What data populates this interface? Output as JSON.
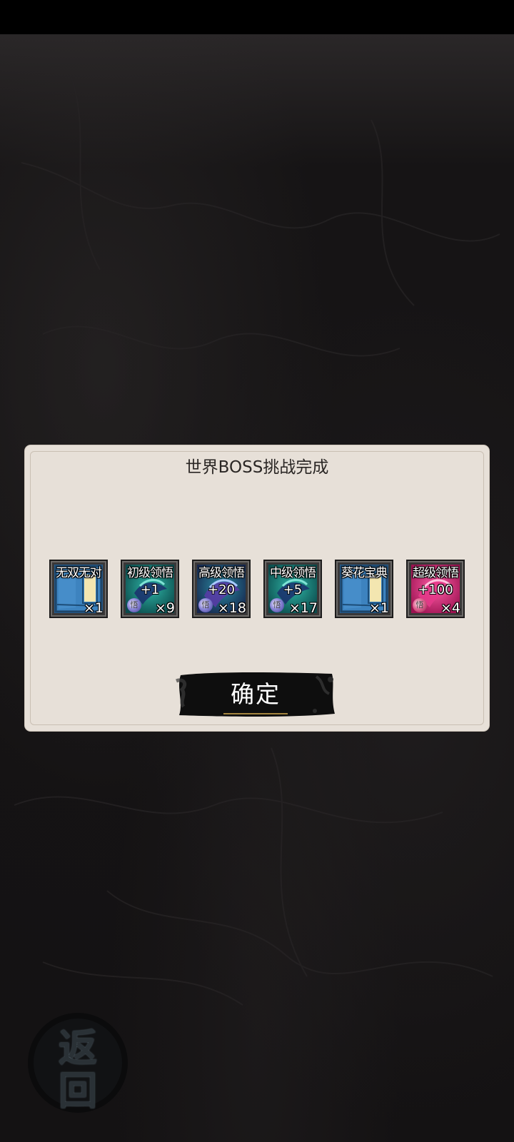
{
  "dialog": {
    "title": "世界BOSS挑战完成",
    "confirm_label": "确定"
  },
  "rewards": [
    {
      "name": "无双无对",
      "bonus": "",
      "count": "×1",
      "icon": "blue-manual-icon"
    },
    {
      "name": "初级领悟",
      "bonus": "+1",
      "count": "×9",
      "icon": "teal-insight-pill-icon"
    },
    {
      "name": "高级领悟",
      "bonus": "+20",
      "count": "×18",
      "icon": "purple-insight-pill-icon"
    },
    {
      "name": "中级领悟",
      "bonus": "+5",
      "count": "×17",
      "icon": "teal-insight-pill-icon"
    },
    {
      "name": "葵花宝典",
      "bonus": "",
      "count": "×1",
      "icon": "blue-manual-icon"
    },
    {
      "name": "超级领悟",
      "bonus": "+100",
      "count": "×4",
      "icon": "pink-insight-pill-icon"
    }
  ],
  "orb_glyph": "悟",
  "back_button": {
    "line1": "返",
    "line2": "回"
  },
  "colors": {
    "dialog_bg": "#e7e0d8",
    "manual_blue": "#2f6fa8",
    "pill_teal": "#13807a",
    "pill_purple": "#2b3f7a",
    "pill_pink": "#d0287a"
  }
}
